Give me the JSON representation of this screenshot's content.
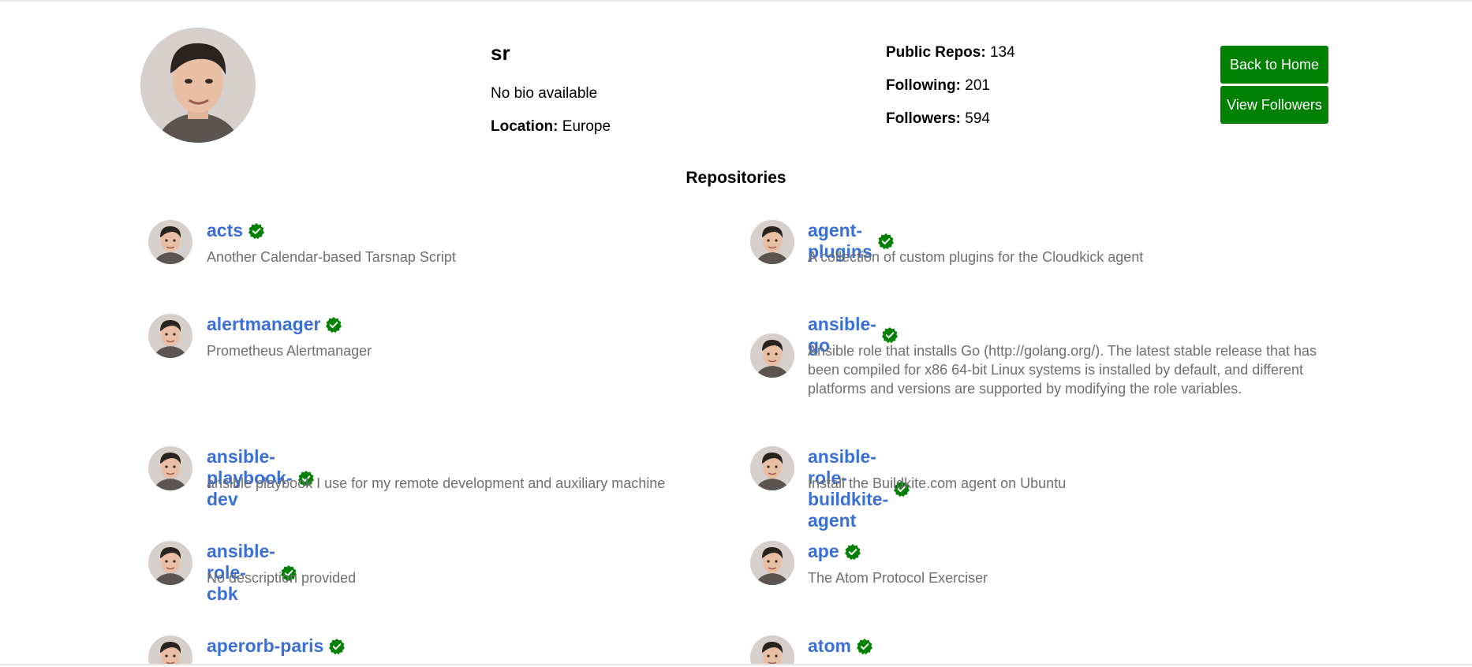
{
  "profile": {
    "username": "sr",
    "bio": "No bio available",
    "location_label": "Location:",
    "location": "Europe",
    "stats": [
      {
        "label": "Public Repos:",
        "value": "134"
      },
      {
        "label": "Following:",
        "value": "201"
      },
      {
        "label": "Followers:",
        "value": "594"
      }
    ]
  },
  "actions": {
    "back_label": "Back to Home",
    "followers_label": "View Followers"
  },
  "repos_title": "Repositories",
  "repos": [
    {
      "name": "acts",
      "description": "Another Calendar-based Tarsnap Script"
    },
    {
      "name": "agent-plugins",
      "description": "A collection of custom plugins for the Cloudkick agent"
    },
    {
      "name": "alertmanager",
      "description": "Prometheus Alertmanager"
    },
    {
      "name": "ansible-go",
      "description": "Ansible role that installs Go (http://golang.org/). The latest stable release that has been compiled for x86 64-bit Linux systems is installed by default, and different platforms and versions are supported by modifying the role variables."
    },
    {
      "name": "ansible-playbook-dev",
      "description": "ansible playbook I use for my remote development and auxiliary machine"
    },
    {
      "name": "ansible-role-buildkite-agent",
      "description": "Install the Buildkite.com agent on Ubuntu"
    },
    {
      "name": "ansible-role-cbk",
      "description": "No description provided"
    },
    {
      "name": "ape",
      "description": "The Atom Protocol Exerciser"
    },
    {
      "name": "aperorb-paris",
      "description": ""
    },
    {
      "name": "atom",
      "description": ""
    }
  ],
  "colors": {
    "accent": "#008000",
    "link": "#3b6fd8",
    "muted": "#6f6f6f"
  },
  "icons": {
    "verified": "verified-badge-icon"
  }
}
